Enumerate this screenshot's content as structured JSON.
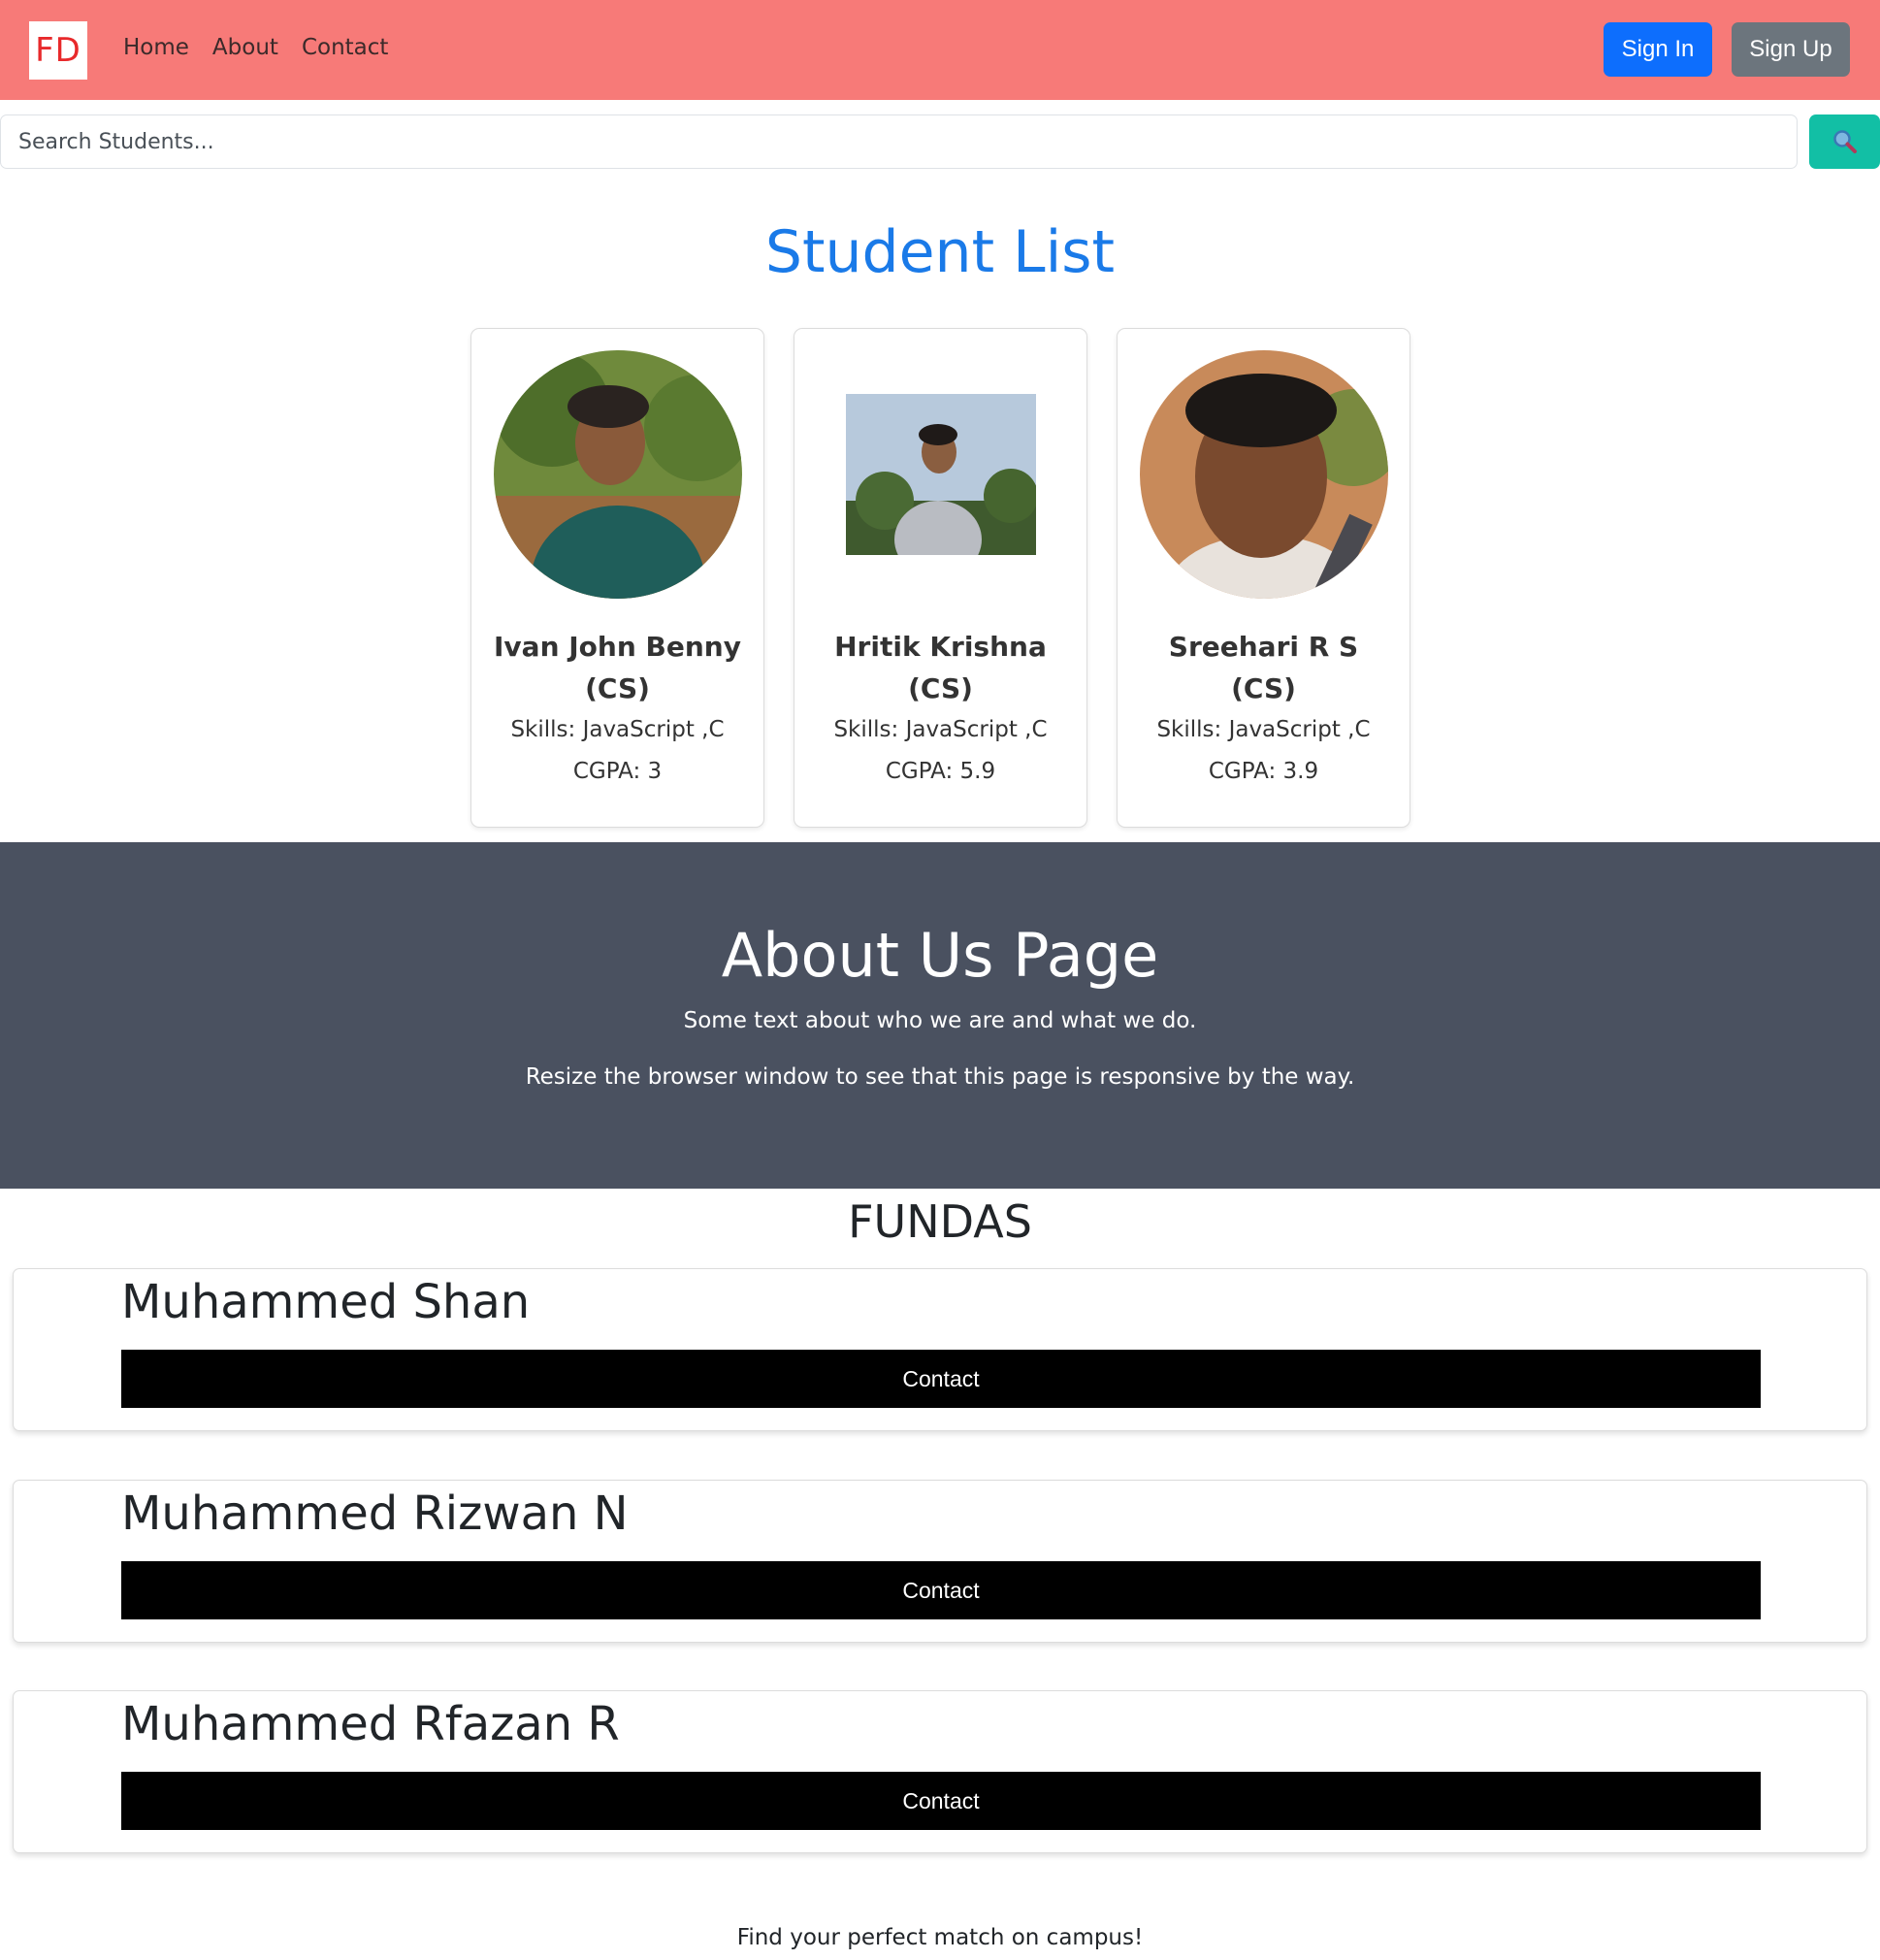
{
  "navbar": {
    "logo_text": "FD",
    "links": [
      "Home",
      "About",
      "Contact"
    ],
    "sign_in": "Sign In",
    "sign_up": "Sign Up",
    "colors": {
      "background": "#f77a78",
      "sign_in": "#0d6efd",
      "sign_up": "#6c757d"
    }
  },
  "search": {
    "placeholder": "Search Students...",
    "button_icon": "search-icon",
    "button_color": "#12bfa5"
  },
  "students": {
    "title": "Student List",
    "items": [
      {
        "name": "Ivan John Benny (CS)",
        "skills": "Skills: JavaScript ,C",
        "cgpa": "CGPA: 3",
        "photo": "student-photo"
      },
      {
        "name": "Hritik Krishna (CS)",
        "skills": "Skills: JavaScript ,C",
        "cgpa": "CGPA: 5.9",
        "photo": "student-photo"
      },
      {
        "name": "Sreehari R S (CS)",
        "skills": "Skills: JavaScript ,C",
        "cgpa": "CGPA: 3.9",
        "photo": "student-photo"
      }
    ]
  },
  "about": {
    "title": "About Us Page",
    "line1": "Some text about who we are and what we do.",
    "line2": "Resize the browser window to see that this page is responsive by the way.",
    "background": "#4a5160"
  },
  "fundas": {
    "title": "FUNDAS",
    "items": [
      {
        "name": "Muhammed Shan",
        "button": "Contact"
      },
      {
        "name": "Muhammed Rizwan N",
        "button": "Contact"
      },
      {
        "name": "Muhammed Rfazan R",
        "button": "Contact"
      }
    ]
  },
  "footer": {
    "tagline": "Find your perfect match on campus!"
  }
}
